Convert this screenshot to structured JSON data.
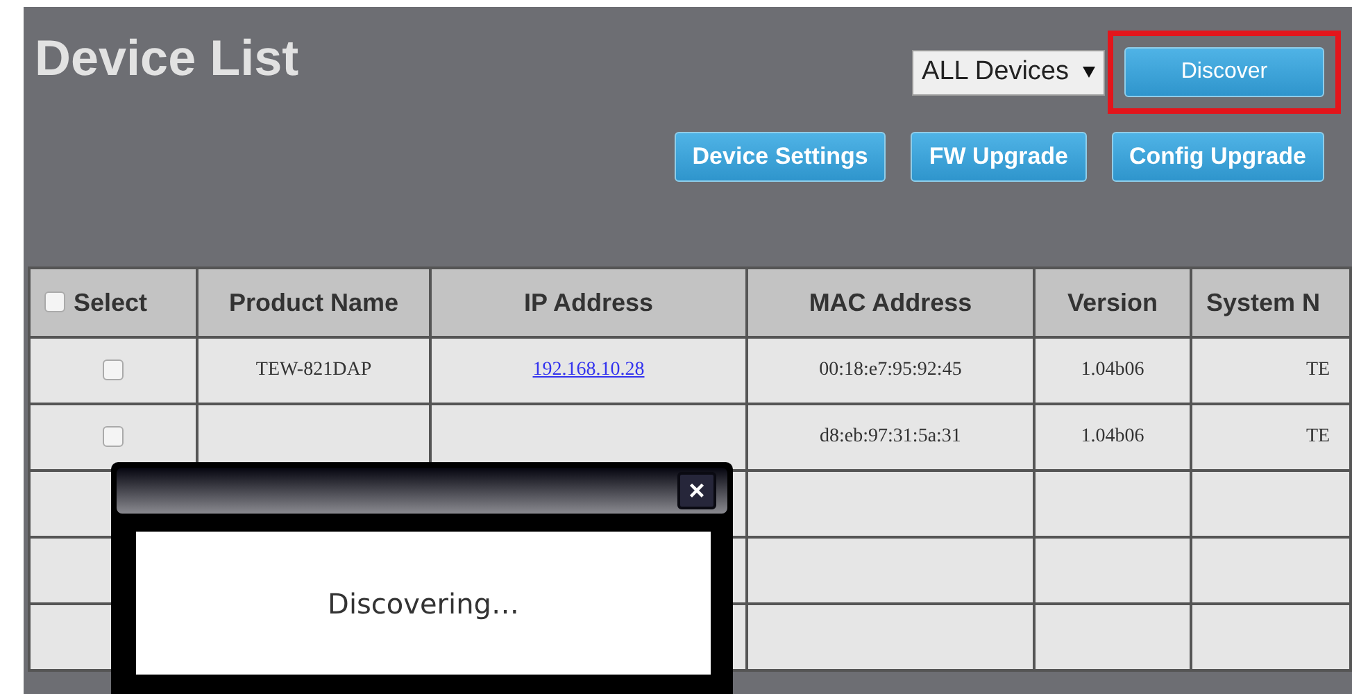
{
  "page": {
    "title": "Device List"
  },
  "filter": {
    "value": "ALL Devices"
  },
  "discover_button": {
    "label": "Discover",
    "highlighted": true
  },
  "actions": [
    "Device Settings",
    "FW Upgrade",
    "Config Upgrade"
  ],
  "table": {
    "select_all": {
      "label": "Select",
      "checked": false
    },
    "columns": [
      "Product Name",
      "IP Address",
      "MAC Address",
      "Version",
      "System N"
    ],
    "rows": [
      {
        "kind": "device",
        "checked": false,
        "cells": [
          "TEW-821DAP",
          "192.168.10.28",
          "00:18:e7:95:92:45",
          "1.04b06",
          "TE"
        ]
      },
      {
        "kind": "device",
        "checked": false,
        "cells": [
          "",
          "",
          "d8:eb:97:31:5a:31",
          "1.04b06",
          "TE"
        ]
      },
      {
        "kind": "empty"
      },
      {
        "kind": "empty"
      },
      {
        "kind": "empty"
      }
    ]
  },
  "dialog": {
    "close": "×",
    "message": "Discovering…"
  }
}
